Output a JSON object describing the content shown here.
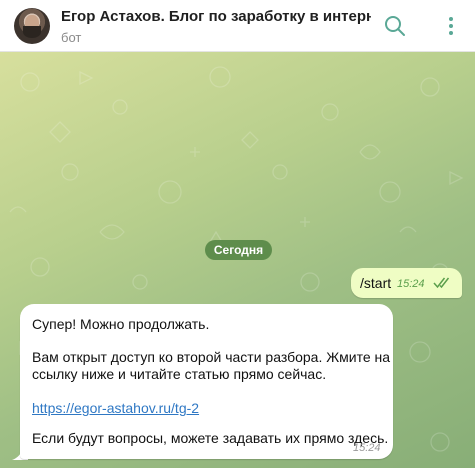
{
  "header": {
    "title": "Егор Астахов. Блог по заработку в интерн...",
    "subtitle": "бот"
  },
  "icons": {
    "search": "search-icon",
    "more": "more-vertical-icon",
    "read": "double-check-icon"
  },
  "colors": {
    "accent": "#5a9e4b",
    "date_pill": "#5e8d4c",
    "outgoing_bubble": "#effdc4",
    "link": "#2f78c4"
  },
  "chat": {
    "date_label": "Сегодня",
    "outgoing": {
      "text": "/start",
      "time": "15:24"
    },
    "incoming": {
      "line1": "Супер! Можно продолжать.",
      "line2": "Вам открыт доступ ко второй части разбора. Жмите на",
      "line3": "ссылку ниже и читайте статью прямо сейчас.",
      "link": "https://egor-astahov.ru/tg-2",
      "line4": "Если будут вопросы, можете задавать их прямо здесь.",
      "time": "15:24"
    }
  }
}
